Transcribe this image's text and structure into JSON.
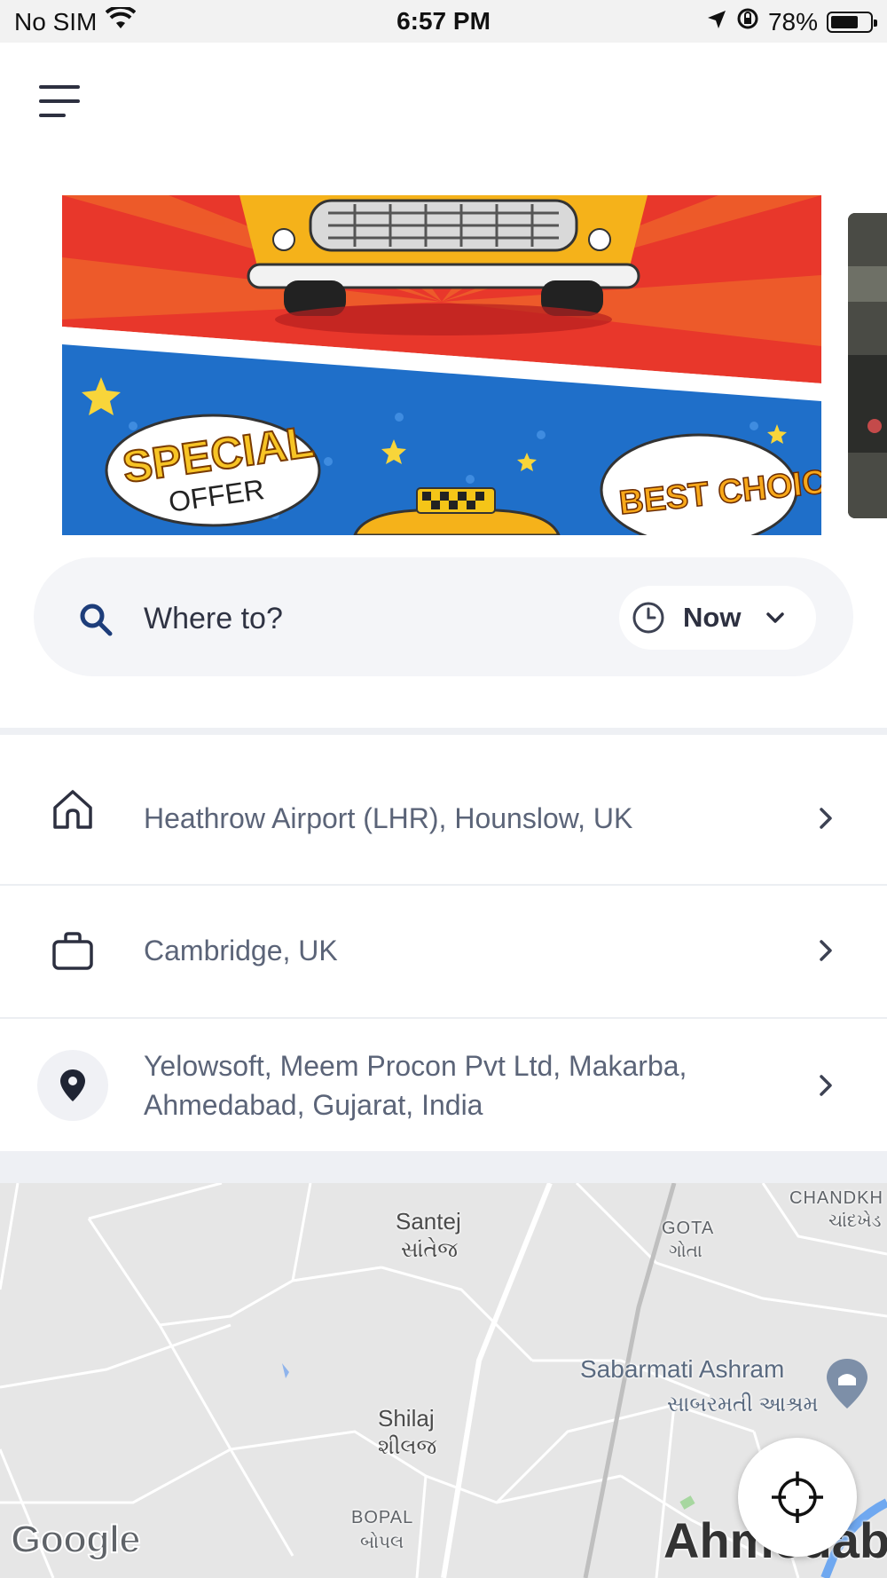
{
  "status_bar": {
    "carrier": "No SIM",
    "time": "6:57 PM",
    "battery": "78%",
    "battery_level": 0.78,
    "icons": [
      "wifi-icon",
      "location-arrow-icon",
      "orientation-lock-icon",
      "battery-icon"
    ]
  },
  "header": {
    "menu_icon": "hamburger-menu-icon"
  },
  "banner": {
    "slides": [
      {
        "badge_left_1": "SPECIAL",
        "badge_left_2": "OFFER",
        "badge_right": "BEST CHOICE"
      },
      {
        "image": "night-city-photo"
      }
    ]
  },
  "search": {
    "placeholder": "Where to?",
    "value": "",
    "time_selector": {
      "label": "Now",
      "icon": "clock-icon",
      "chevron": "chevron-down-icon"
    }
  },
  "places": [
    {
      "icon": "home-icon",
      "label": "Heathrow Airport (LHR), Hounslow, UK"
    },
    {
      "icon": "briefcase-icon",
      "label": "Cambridge, UK"
    },
    {
      "icon": "map-pin-icon",
      "label": "Yelowsoft, Meem Procon Pvt Ltd, Makarba, Ahmedabad, Gujarat, India"
    }
  ],
  "map": {
    "labels": {
      "santej": "Santej",
      "santej_local": "સાંતેજ",
      "gota": "GOTA",
      "gota_local": "ગોતા",
      "chandkheda": "CHANDKH",
      "chandkheda_local": "ચાંદખેડ",
      "sabarmati": "Sabarmati Ashram",
      "sabarmati_local": "સાબરમતી આશ્રમ",
      "shilaj": "Shilaj",
      "shilaj_local": "શીલજ",
      "bopal": "BOPAL",
      "bopal_local": "બોપલ",
      "ahmedabad": "Ahmedab"
    },
    "attribution": "Google",
    "locate_icon": "crosshair-icon",
    "colors": {
      "land": "#e6e6e6",
      "road": "#ffffff",
      "water": "#6fa8f0",
      "poi": "#7d8fa8"
    }
  },
  "colors": {
    "accent_text": "#2d3040",
    "secondary_text": "#5b6478",
    "search_bg": "#f4f5f8"
  }
}
